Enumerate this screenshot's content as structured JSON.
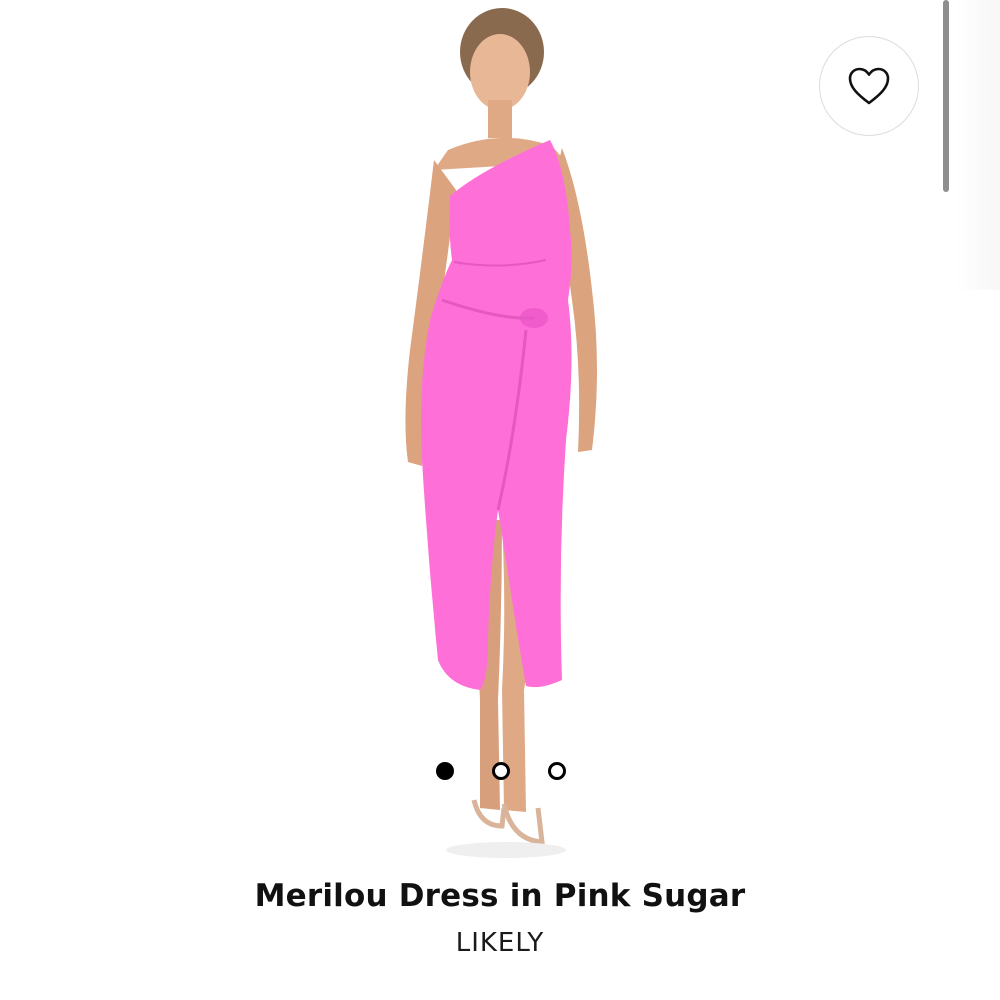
{
  "favorite": {
    "icon": "heart-outline-icon",
    "selected": false
  },
  "gallery": {
    "image_alt": "Model wearing the Merilou Dress in Pink Sugar",
    "dress_color": "#ff6fd8",
    "active_index": 0,
    "total_images": 3
  },
  "product": {
    "title": "Merilou Dress in Pink Sugar",
    "brand": "LIKELY"
  }
}
